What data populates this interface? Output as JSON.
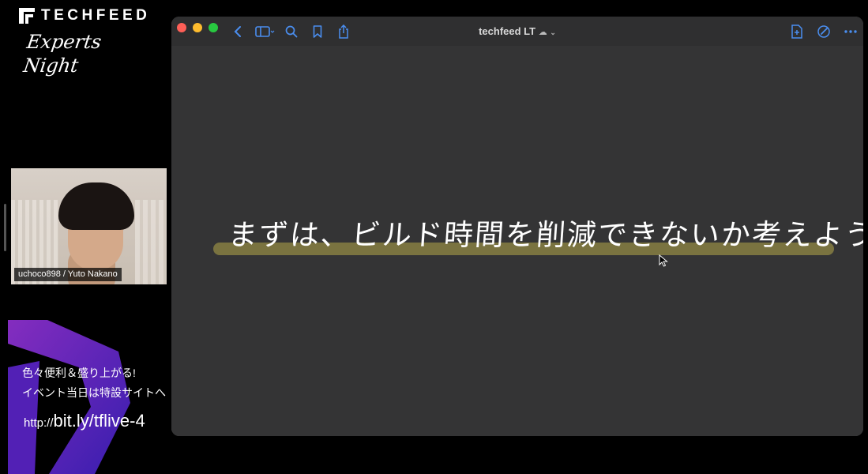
{
  "brand": {
    "wordmark": "TECHFEED",
    "subtitle": "Experts Night"
  },
  "webcam": {
    "name_label": "uchoco898 / Yuto Nakano"
  },
  "promo": {
    "line1": "色々便利＆盛り上がる!",
    "line2": "イベント当日は特設サイトへ",
    "url_prefix": "http://",
    "url_main": "bit.ly/tflive-4",
    "colors": {
      "stripe_purple": "#6a2ad8",
      "stripe_violet": "#8b2fc9"
    }
  },
  "window": {
    "title": "techfeed LT",
    "toolbar_icons": [
      "back-icon",
      "sidebar-icon",
      "search-icon",
      "bookmark-icon",
      "share-icon",
      "new-note-icon",
      "compose-icon",
      "more-icon"
    ],
    "handwriting": "まずは、ビルド時間を削減できないか考えよう。",
    "colors": {
      "highlight": "#7a7340",
      "canvas": "#343435"
    }
  }
}
